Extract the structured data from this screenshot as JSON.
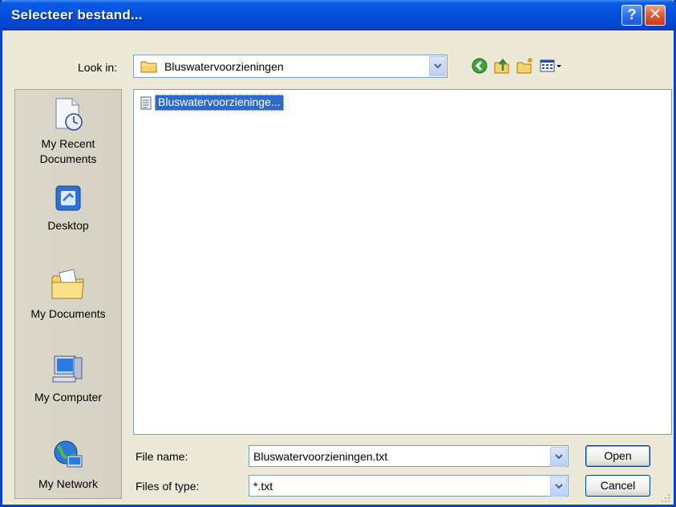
{
  "window": {
    "title": "Selecteer bestand...",
    "help_label": "?",
    "close_label": "✕"
  },
  "lookin": {
    "label": "Look in:",
    "value": "Bluswatervoorzieningen"
  },
  "toolbar": {
    "icons": [
      "back-icon",
      "up-folder-icon",
      "new-folder-icon",
      "views-menu-icon"
    ]
  },
  "places": [
    {
      "label": "My Recent\nDocuments",
      "icon": "recent-documents-icon"
    },
    {
      "label": "Desktop",
      "icon": "desktop-icon"
    },
    {
      "label": "My Documents",
      "icon": "my-documents-icon"
    },
    {
      "label": "My Computer",
      "icon": "my-computer-icon"
    },
    {
      "label": "My Network",
      "icon": "my-network-icon"
    }
  ],
  "files": [
    {
      "name": "Bluswatervoorzieninge...",
      "icon": "text-file-icon",
      "selected": true
    }
  ],
  "filename": {
    "label": "File name:",
    "value": "Bluswatervoorzieningen.txt"
  },
  "filetype": {
    "label": "Files of type:",
    "value": "*.txt"
  },
  "buttons": {
    "open": "Open",
    "cancel": "Cancel"
  },
  "colors": {
    "titlebar": "#0451dc",
    "selection": "#316ac5",
    "dialog_bg": "#ece9d8"
  }
}
